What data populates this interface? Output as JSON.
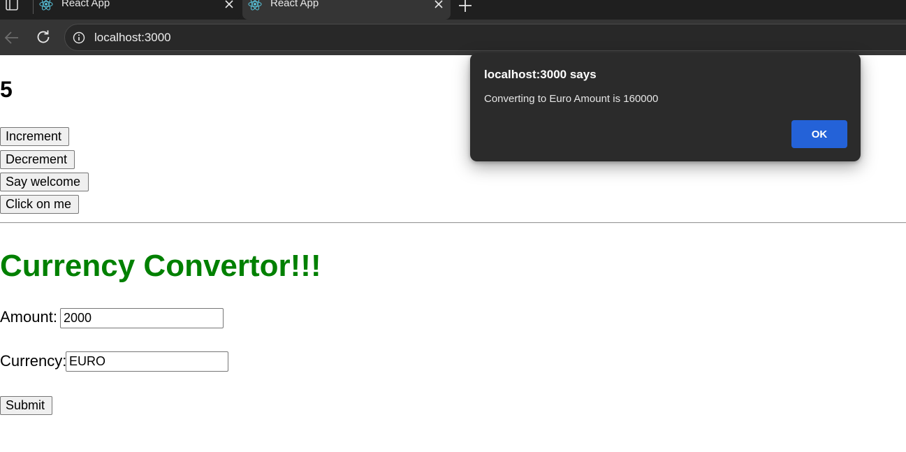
{
  "browser": {
    "tabs": [
      {
        "title": "React App",
        "icon": "react-logo-icon",
        "active": false
      },
      {
        "title": "React App",
        "icon": "react-logo-icon",
        "active": true
      }
    ],
    "url": "localhost:3000",
    "colors": {
      "tabstrip": "#1f1f1f",
      "toolbar": "#353535",
      "omnibox": "#282828",
      "react_logo": "#58c4dc"
    }
  },
  "page": {
    "counter": "5",
    "buttons": {
      "increment": "Increment",
      "decrement": "Decrement",
      "welcome": "Say welcome",
      "click": "Click on me"
    },
    "converter": {
      "title": "Currency Convertor!!!",
      "title_color": "#008000",
      "amount_label": "Amount:",
      "amount_value": "2000",
      "currency_label": "Currency:",
      "currency_value": "EURO",
      "submit": "Submit"
    }
  },
  "alert": {
    "title": "localhost:3000 says",
    "message": "Converting to Euro Amount is 160000",
    "ok": "OK",
    "button_color": "#2462d8"
  }
}
